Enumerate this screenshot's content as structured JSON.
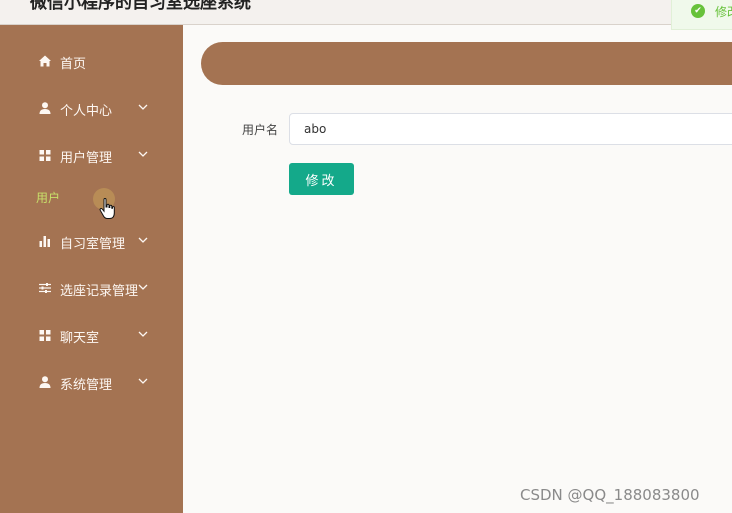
{
  "app": {
    "title": "微信小程序的自习室选座系统"
  },
  "toast": {
    "text": "修改成功"
  },
  "sidebar": {
    "items": [
      {
        "label": "首页",
        "icon": "home-icon"
      },
      {
        "label": "个人中心",
        "icon": "user-icon"
      },
      {
        "label": "用户管理",
        "icon": "grid-icon"
      },
      {
        "label": "自习室管理",
        "icon": "bar-chart-icon"
      },
      {
        "label": "选座记录管理",
        "icon": "sliders-icon"
      },
      {
        "label": "聊天室",
        "icon": "grid-icon"
      },
      {
        "label": "系统管理",
        "icon": "user-icon"
      }
    ],
    "sub_item": "用户"
  },
  "form": {
    "username_label": "用户名",
    "username_value": "abo",
    "submit_label": "修改"
  },
  "watermark": "CSDN @QQ_188083800",
  "colors": {
    "sidebar": "#a47352",
    "accent_button": "#14a98a",
    "sub_item_active": "#c8e06a",
    "toast_success": "#67c23a"
  }
}
